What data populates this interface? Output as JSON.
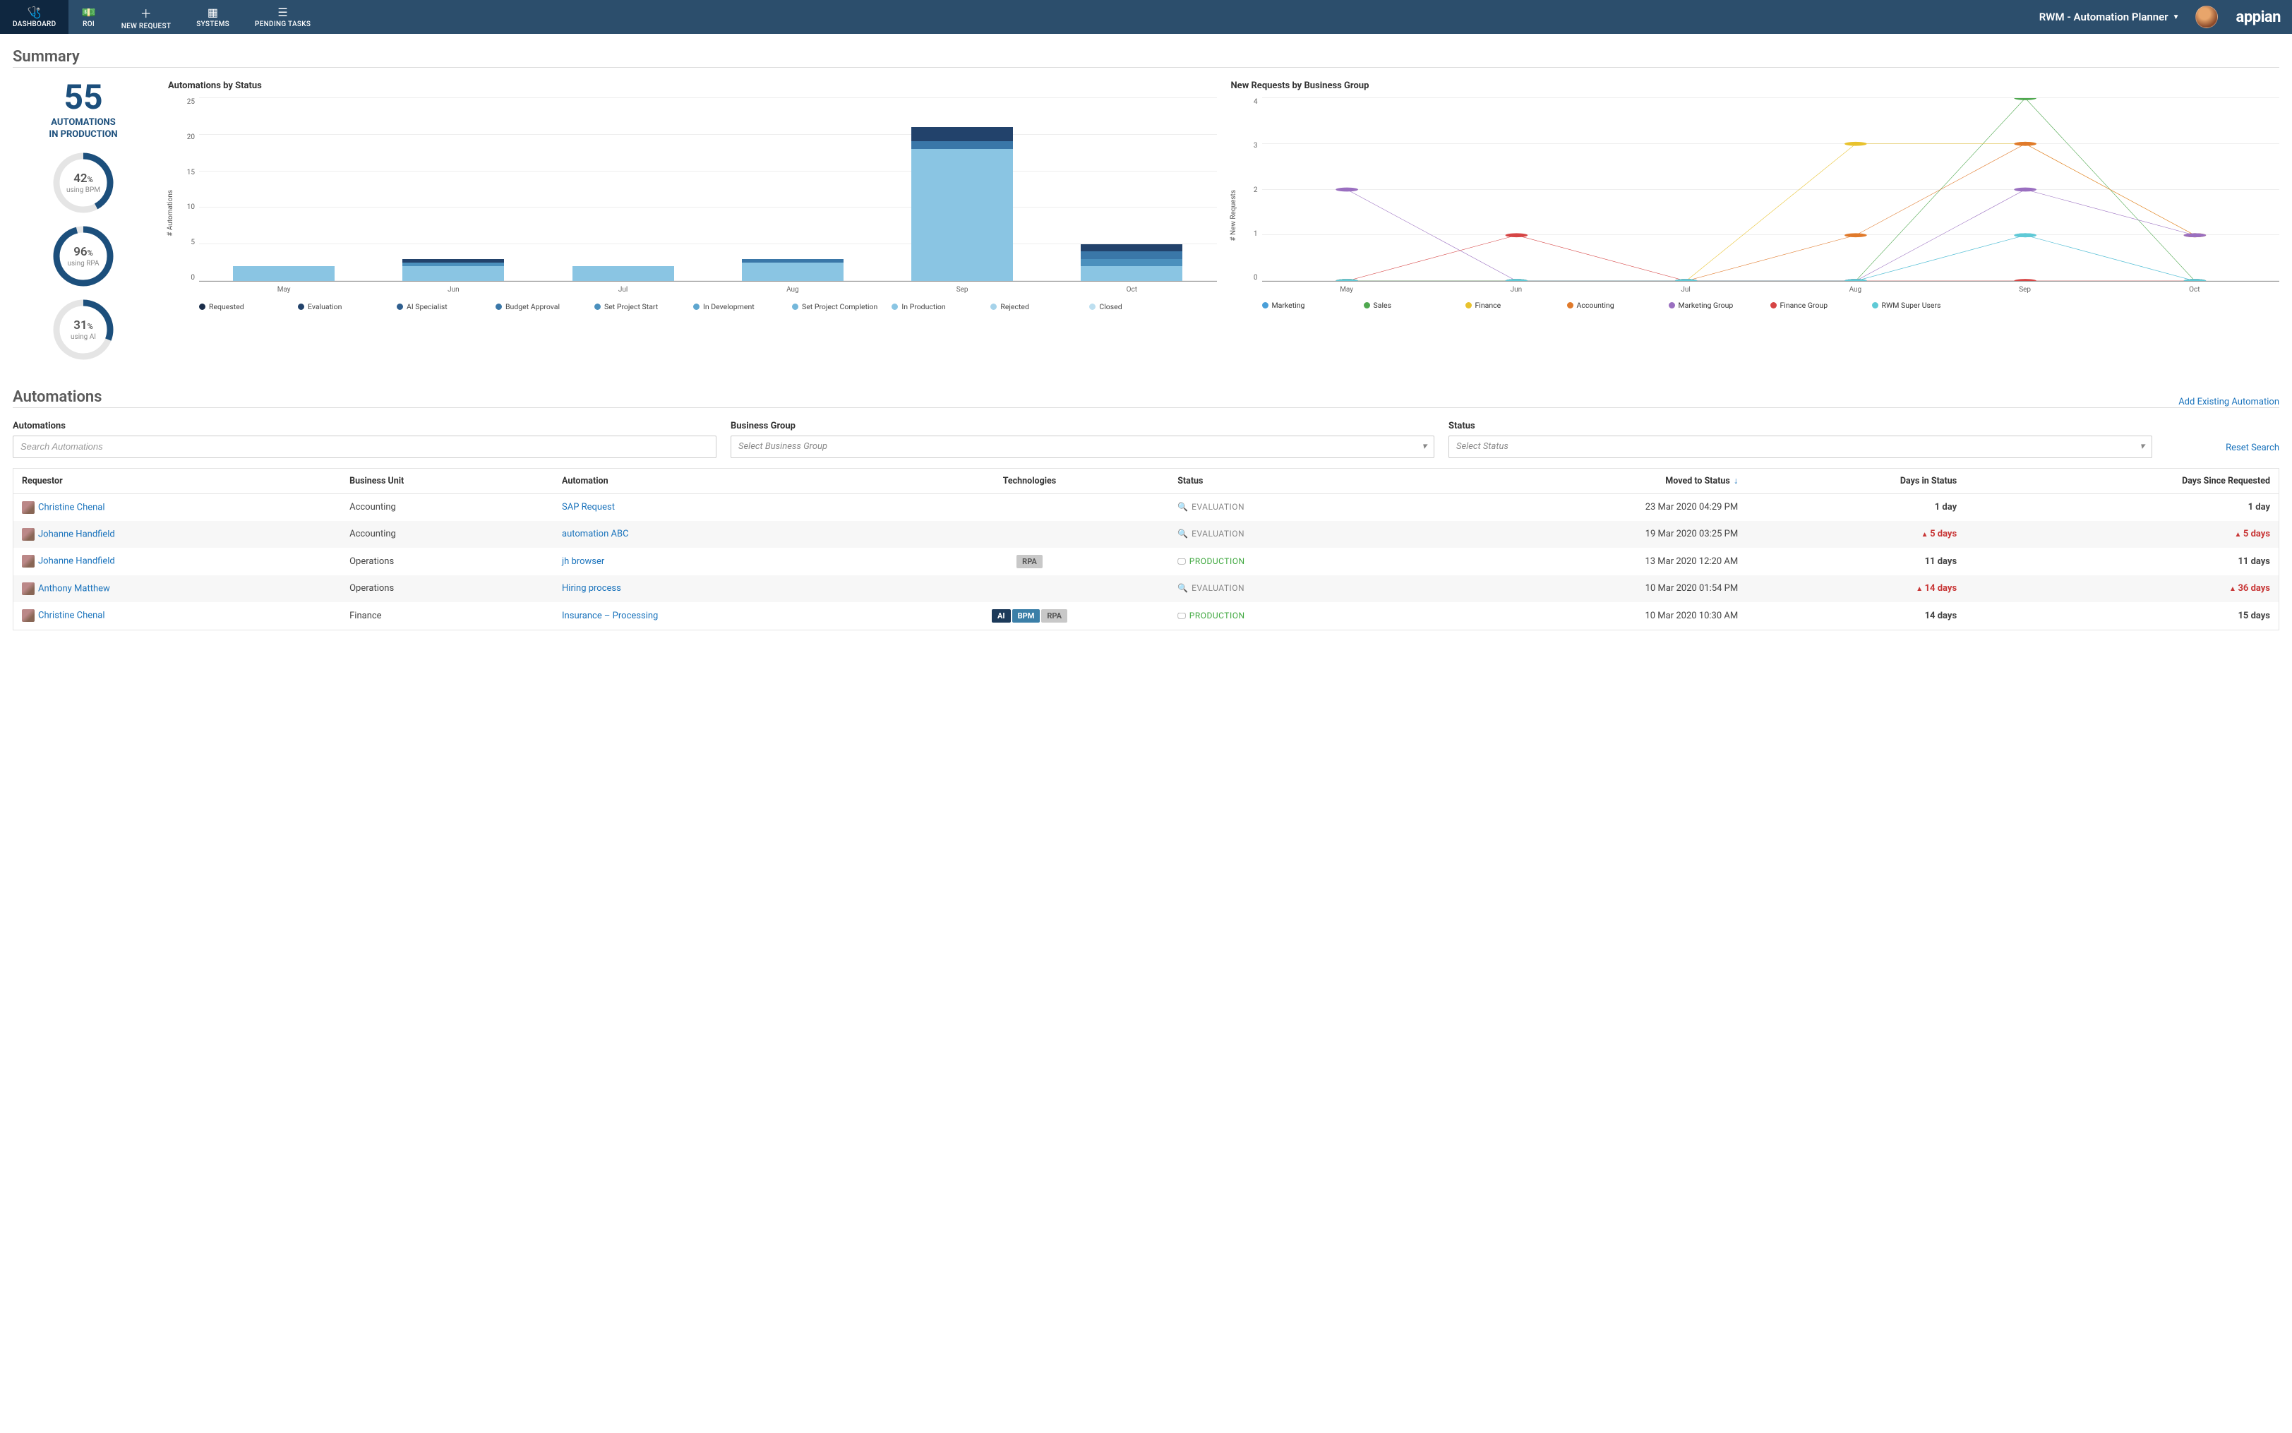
{
  "nav": {
    "items": [
      {
        "label": "DASHBOARD",
        "icon": "🩺"
      },
      {
        "label": "ROI",
        "icon": "💵"
      },
      {
        "label": "NEW REQUEST",
        "icon": "＋"
      },
      {
        "label": "SYSTEMS",
        "icon": "▦"
      },
      {
        "label": "PENDING TASKS",
        "icon": "☰"
      }
    ],
    "app_name": "RWM - Automation Planner",
    "logo": "appian"
  },
  "sections": {
    "summary_title": "Summary",
    "automations_title": "Automations",
    "add_link": "Add Existing Automation"
  },
  "kpi": {
    "big_value": "55",
    "big_label_1": "AUTOMATIONS",
    "big_label_2": "IN PRODUCTION",
    "gauges": [
      {
        "pct": 42,
        "label": "using BPM",
        "color": "#1c4f7c"
      },
      {
        "pct": 96,
        "label": "using RPA",
        "color": "#1c4f7c"
      },
      {
        "pct": 31,
        "label": "using AI",
        "color": "#1c4f7c"
      }
    ]
  },
  "chart_data": [
    {
      "type": "bar",
      "title": "Automations by Status",
      "ylabel": "# Automations",
      "ylim": [
        0,
        25
      ],
      "yticks": [
        0,
        5,
        10,
        15,
        20,
        25
      ],
      "categories": [
        "May",
        "Jun",
        "Jul",
        "Aug",
        "Sep",
        "Oct"
      ],
      "series": [
        {
          "name": "Requested",
          "color": "#1b2e4a",
          "values": [
            0,
            0,
            0,
            0,
            0,
            0
          ]
        },
        {
          "name": "Evaluation",
          "color": "#22426b",
          "values": [
            0,
            0.5,
            0,
            0,
            2,
            1
          ]
        },
        {
          "name": "AI Specialist",
          "color": "#2f5f8f",
          "values": [
            0,
            0,
            0,
            0,
            0,
            0
          ]
        },
        {
          "name": "Budget Approval",
          "color": "#3a77a8",
          "values": [
            0,
            0,
            0,
            0.5,
            1,
            1
          ]
        },
        {
          "name": "Set Project Start",
          "color": "#4b90bd",
          "values": [
            0,
            0.5,
            0,
            0,
            0,
            1
          ]
        },
        {
          "name": "In Development",
          "color": "#5ea6cf",
          "values": [
            0,
            0,
            0,
            0,
            0,
            0
          ]
        },
        {
          "name": "Set Project Completion",
          "color": "#74b7da",
          "values": [
            0,
            0,
            0,
            0,
            0,
            0
          ]
        },
        {
          "name": "In Production",
          "color": "#8ac5e3",
          "values": [
            2,
            2,
            2,
            2.5,
            18,
            2
          ]
        },
        {
          "name": "Rejected",
          "color": "#a6d3ea",
          "values": [
            0,
            0,
            0,
            0,
            0,
            0
          ]
        },
        {
          "name": "Closed",
          "color": "#bddff0",
          "values": [
            0,
            0,
            0,
            0,
            0,
            0
          ]
        }
      ]
    },
    {
      "type": "line",
      "title": "New Requests by Business Group",
      "ylabel": "# New Requests",
      "ylim": [
        0,
        4
      ],
      "yticks": [
        0,
        1,
        2,
        3,
        4
      ],
      "categories": [
        "May",
        "Jun",
        "Jul",
        "Aug",
        "Sep",
        "Oct"
      ],
      "series": [
        {
          "name": "Marketing",
          "color": "#4a9fd8",
          "marker": "circle",
          "values": [
            0,
            0,
            0,
            0,
            1,
            0
          ]
        },
        {
          "name": "Sales",
          "color": "#4fa84f",
          "marker": "diamond",
          "values": [
            0,
            0,
            0,
            0,
            4,
            0
          ]
        },
        {
          "name": "Finance",
          "color": "#e8c22d",
          "marker": "square",
          "values": [
            0,
            0,
            0,
            3,
            3,
            1
          ]
        },
        {
          "name": "Accounting",
          "color": "#e07a2b",
          "marker": "triangle-up",
          "values": [
            0,
            0,
            0,
            1,
            3,
            1
          ]
        },
        {
          "name": "Marketing Group",
          "color": "#9a6fc0",
          "marker": "triangle-down",
          "values": [
            2,
            0,
            0,
            0,
            2,
            1
          ]
        },
        {
          "name": "Finance Group",
          "color": "#d64545",
          "marker": "circle",
          "values": [
            0,
            1,
            0,
            0,
            0,
            0
          ]
        },
        {
          "name": "RWM Super Users",
          "color": "#5fcad6",
          "marker": "square",
          "values": [
            0,
            0,
            0,
            0,
            1,
            0
          ]
        }
      ]
    }
  ],
  "filters": {
    "automations_label": "Automations",
    "automations_placeholder": "Search Automations",
    "group_label": "Business Group",
    "group_placeholder": "Select Business Group",
    "status_label": "Status",
    "status_placeholder": "Select Status",
    "reset": "Reset Search"
  },
  "table": {
    "columns": [
      "Requestor",
      "Business Unit",
      "Automation",
      "Technologies",
      "Status",
      "Moved to Status",
      "Days in Status",
      "Days Since Requested"
    ],
    "rows": [
      {
        "requestor": "Christine Chenal",
        "bu": "Accounting",
        "automation": "SAP Request",
        "tech": [],
        "status": "EVALUATION",
        "status_kind": "eval",
        "moved": "23 Mar 2020 04:29 PM",
        "days_in": "1 day",
        "days_in_warn": false,
        "since": "1 day",
        "since_warn": false
      },
      {
        "requestor": "Johanne Handfield",
        "bu": "Accounting",
        "automation": "automation ABC",
        "tech": [],
        "status": "EVALUATION",
        "status_kind": "eval",
        "moved": "19 Mar 2020 03:25 PM",
        "days_in": "5 days",
        "days_in_warn": true,
        "since": "5 days",
        "since_warn": true
      },
      {
        "requestor": "Johanne Handfield",
        "bu": "Operations",
        "automation": "jh browser",
        "tech": [
          "RPA"
        ],
        "status": "PRODUCTION",
        "status_kind": "prod",
        "moved": "13 Mar 2020 12:20 AM",
        "days_in": "11 days",
        "days_in_warn": false,
        "since": "11 days",
        "since_warn": false
      },
      {
        "requestor": "Anthony Matthew",
        "bu": "Operations",
        "automation": "Hiring process",
        "tech": [],
        "status": "EVALUATION",
        "status_kind": "eval",
        "moved": "10 Mar 2020 01:54 PM",
        "days_in": "14 days",
        "days_in_warn": true,
        "since": "36 days",
        "since_warn": true
      },
      {
        "requestor": "Christine Chenal",
        "bu": "Finance",
        "automation": "Insurance – Processing",
        "tech": [
          "AI",
          "BPM",
          "RPA"
        ],
        "status": "PRODUCTION",
        "status_kind": "prod",
        "moved": "10 Mar 2020 10:30 AM",
        "days_in": "14 days",
        "days_in_warn": false,
        "since": "15 days",
        "since_warn": false
      }
    ]
  }
}
